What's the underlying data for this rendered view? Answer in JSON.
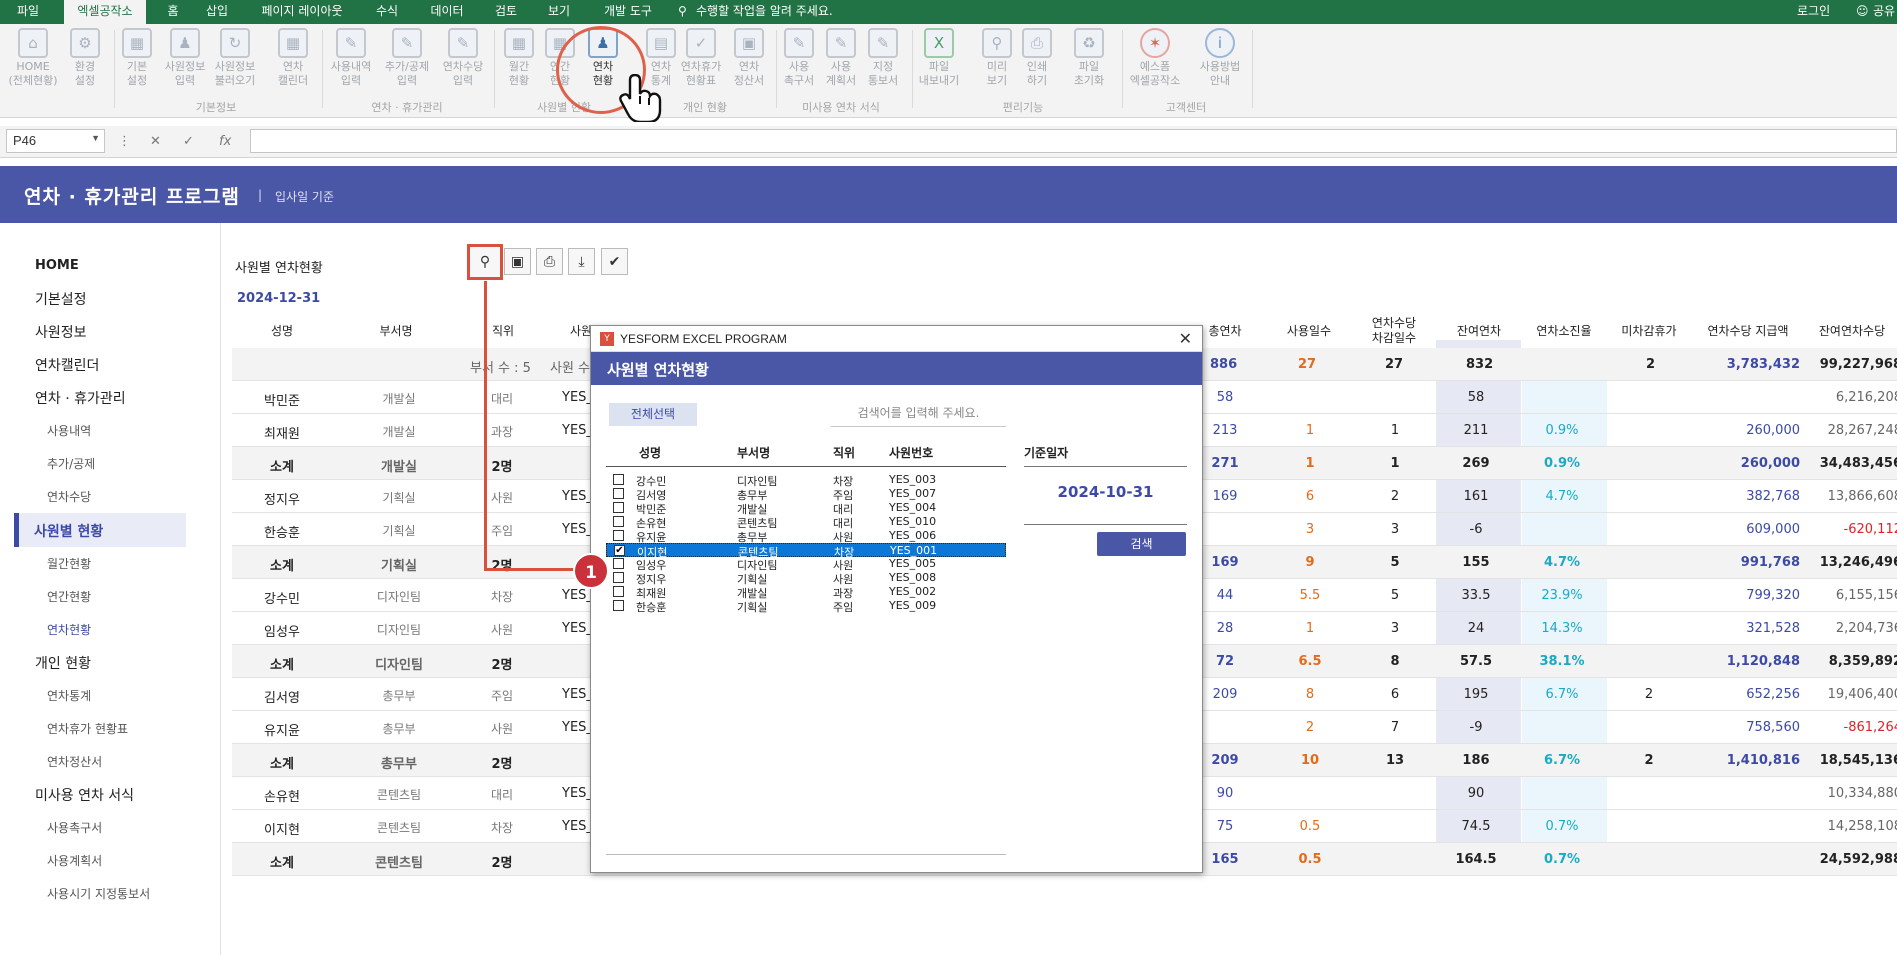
{
  "ribbon_tabs": [
    "파일",
    "엑셀공작소",
    "홈",
    "삽입",
    "페이지 레이아웃",
    "수식",
    "데이터",
    "검토",
    "보기",
    "개발 도구"
  ],
  "tell_me": "수행할 작업을 알려 주세요.",
  "login": "로그인",
  "share": "공유",
  "ribbon_buttons": [
    "HOME\n(전체현황)",
    "환경\n설정",
    "기본\n설정",
    "사원정보\n입력",
    "사원정보\n불러오기",
    "연차\n캘린더",
    "사용내역\n입력",
    "추가/공제\n입력",
    "연차수당\n입력",
    "월간\n현황",
    "연간\n현황",
    "연차\n현황",
    "연차\n통계",
    "연차휴가\n현황표",
    "연차\n정산서",
    "사용\n촉구서",
    "사용\n계획서",
    "지정\n통보서",
    "파일\n내보내기",
    "미리\n보기",
    "인쇄\n하기",
    "파일\n초기화",
    "예스폼\n엑셀공작소",
    "사용방법\n안내"
  ],
  "ribbon_groups": [
    "기본정보",
    "연차 · 휴가관리",
    "사원별 현황",
    "개인 현황",
    "미사용 연차 서식",
    "편리기능",
    "고객센터"
  ],
  "name_box": "P46",
  "app": {
    "title": "연차 · 휴가관리 프로그램",
    "subtitle": "입사일 기준"
  },
  "sidebar": {
    "items": [
      "HOME",
      "기본설정",
      "사원정보",
      "연차캘린더",
      "연차 · 휴가관리",
      "사용내역",
      "추가/공제",
      "연차수당",
      "사원별 현황",
      "월간현황",
      "연간현황",
      "연차현황",
      "개인 현황",
      "연차통계",
      "연차휴가 현황표",
      "연차정산서",
      "미사용 연차 서식",
      "사용촉구서",
      "사용계획서",
      "사용시기 지정통보서"
    ]
  },
  "main": {
    "title": "사원별 연차현황",
    "date": "2024-12-31"
  },
  "table": {
    "headers": [
      "성명",
      "부서명",
      "직위",
      "사원",
      "총연차",
      "사용일수",
      "연차수당\n차감일수",
      "잔여연차",
      "연차소진율",
      "미차감휴가",
      "연차수당 지급액",
      "잔여연차수당"
    ],
    "summary": {
      "dept_count": "부서 수 : 5",
      "emp_label": "사원 수",
      "total": "886",
      "used": "27",
      "deduct": "27",
      "remain": "832",
      "unded": "2",
      "paid": "3,783,432",
      "remain_pay": "99,227,968"
    },
    "rows": [
      {
        "type": "emp",
        "name": "박민준",
        "dept": "개발실",
        "pos": "대리",
        "id": "YES_",
        "total": "58",
        "used": "",
        "deduct": "",
        "remain": "58",
        "rate": "",
        "unded": "",
        "paid": "",
        "remain_pay": "6,216,208"
      },
      {
        "type": "emp",
        "name": "최재원",
        "dept": "개발실",
        "pos": "과장",
        "id": "YES_",
        "total": "213",
        "used": "1",
        "deduct": "1",
        "remain": "211",
        "rate": "0.9%",
        "unded": "",
        "paid": "260,000",
        "remain_pay": "28,267,248"
      },
      {
        "type": "sub",
        "name": "소계",
        "dept": "개발실",
        "pos": "2명",
        "id": "",
        "total": "271",
        "used": "1",
        "deduct": "1",
        "remain": "269",
        "rate": "0.9%",
        "unded": "",
        "paid": "260,000",
        "remain_pay": "34,483,456"
      },
      {
        "type": "emp",
        "name": "정지우",
        "dept": "기획실",
        "pos": "사원",
        "id": "YES_",
        "total": "169",
        "used": "6",
        "deduct": "2",
        "remain": "161",
        "rate": "4.7%",
        "unded": "",
        "paid": "382,768",
        "remain_pay": "13,866,608"
      },
      {
        "type": "emp",
        "name": "한승훈",
        "dept": "기획실",
        "pos": "주임",
        "id": "YES_",
        "total": "",
        "used": "3",
        "deduct": "3",
        "remain": "-6",
        "rate": "",
        "unded": "",
        "paid": "609,000",
        "remain_pay": "-620,112"
      },
      {
        "type": "sub",
        "name": "소계",
        "dept": "기획실",
        "pos": "2명",
        "id": "",
        "total": "169",
        "used": "9",
        "deduct": "5",
        "remain": "155",
        "rate": "4.7%",
        "unded": "",
        "paid": "991,768",
        "remain_pay": "13,246,496"
      },
      {
        "type": "emp",
        "name": "강수민",
        "dept": "디자인팀",
        "pos": "차장",
        "id": "YES_",
        "total": "44",
        "used": "5.5",
        "deduct": "5",
        "remain": "33.5",
        "rate": "23.9%",
        "unded": "",
        "paid": "799,320",
        "remain_pay": "6,155,156"
      },
      {
        "type": "emp",
        "name": "임성우",
        "dept": "디자인팀",
        "pos": "사원",
        "id": "YES_",
        "total": "28",
        "used": "1",
        "deduct": "3",
        "remain": "24",
        "rate": "14.3%",
        "unded": "",
        "paid": "321,528",
        "remain_pay": "2,204,736"
      },
      {
        "type": "sub",
        "name": "소계",
        "dept": "디자인팀",
        "pos": "2명",
        "id": "",
        "total": "72",
        "used": "6.5",
        "deduct": "8",
        "remain": "57.5",
        "rate": "38.1%",
        "unded": "",
        "paid": "1,120,848",
        "remain_pay": "8,359,892"
      },
      {
        "type": "emp",
        "name": "김서영",
        "dept": "총무부",
        "pos": "주임",
        "id": "YES_",
        "total": "209",
        "used": "8",
        "deduct": "6",
        "remain": "195",
        "rate": "6.7%",
        "unded": "2",
        "paid": "652,256",
        "remain_pay": "19,406,400"
      },
      {
        "type": "emp",
        "name": "유지윤",
        "dept": "총무부",
        "pos": "사원",
        "id": "YES_",
        "total": "",
        "used": "2",
        "deduct": "7",
        "remain": "-9",
        "rate": "",
        "unded": "",
        "paid": "758,560",
        "remain_pay": "-861,264"
      },
      {
        "type": "sub",
        "name": "소계",
        "dept": "총무부",
        "pos": "2명",
        "id": "",
        "total": "209",
        "used": "10",
        "deduct": "13",
        "remain": "186",
        "rate": "6.7%",
        "unded": "2",
        "paid": "1,410,816",
        "remain_pay": "18,545,136"
      },
      {
        "type": "emp",
        "name": "손유현",
        "dept": "콘텐츠팀",
        "pos": "대리",
        "id": "YES_",
        "total": "90",
        "used": "",
        "deduct": "",
        "remain": "90",
        "rate": "",
        "unded": "",
        "paid": "",
        "remain_pay": "10,334,880"
      },
      {
        "type": "emp",
        "name": "이지현",
        "dept": "콘텐츠팀",
        "pos": "차장",
        "id": "YES_",
        "total": "75",
        "used": "0.5",
        "deduct": "",
        "remain": "74.5",
        "rate": "0.7%",
        "unded": "",
        "paid": "",
        "remain_pay": "14,258,108"
      },
      {
        "type": "sub",
        "name": "소계",
        "dept": "콘텐츠팀",
        "pos": "2명",
        "id": "",
        "total": "165",
        "used": "0.5",
        "deduct": "",
        "remain": "164.5",
        "rate": "0.7%",
        "unded": "",
        "paid": "",
        "remain_pay": "24,592,988"
      }
    ]
  },
  "dialog": {
    "window_title": "YESFORM EXCEL PROGRAM",
    "title": "사원별 연차현황",
    "select_all": "전체선택",
    "search_placeholder": "검색어를 입력해 주세요.",
    "list_headers": [
      "성명",
      "부서명",
      "직위",
      "사원번호"
    ],
    "date_label": "기준일자",
    "date_value": "2024-10-31",
    "search_button": "검색",
    "employees": [
      {
        "name": "강수민",
        "dept": "디자인팀",
        "pos": "차장",
        "id": "YES_003",
        "checked": false
      },
      {
        "name": "김서영",
        "dept": "총무부",
        "pos": "주임",
        "id": "YES_007",
        "checked": false
      },
      {
        "name": "박민준",
        "dept": "개발실",
        "pos": "대리",
        "id": "YES_004",
        "checked": false
      },
      {
        "name": "손유현",
        "dept": "콘텐츠팀",
        "pos": "대리",
        "id": "YES_010",
        "checked": false
      },
      {
        "name": "유지윤",
        "dept": "총무부",
        "pos": "사원",
        "id": "YES_006",
        "checked": false
      },
      {
        "name": "이지현",
        "dept": "콘텐츠팀",
        "pos": "차장",
        "id": "YES_001",
        "checked": true
      },
      {
        "name": "임성우",
        "dept": "디자인팀",
        "pos": "사원",
        "id": "YES_005",
        "checked": false
      },
      {
        "name": "정지우",
        "dept": "기획실",
        "pos": "사원",
        "id": "YES_008",
        "checked": false
      },
      {
        "name": "최재원",
        "dept": "개발실",
        "pos": "과장",
        "id": "YES_002",
        "checked": false
      },
      {
        "name": "한승훈",
        "dept": "기획실",
        "pos": "주임",
        "id": "YES_009",
        "checked": false
      }
    ]
  },
  "badge": "1",
  "colors": {
    "accent": "#4a56a6",
    "excel_green": "#217346",
    "highlight": "#d9503e",
    "selection": "#0b78d7"
  }
}
